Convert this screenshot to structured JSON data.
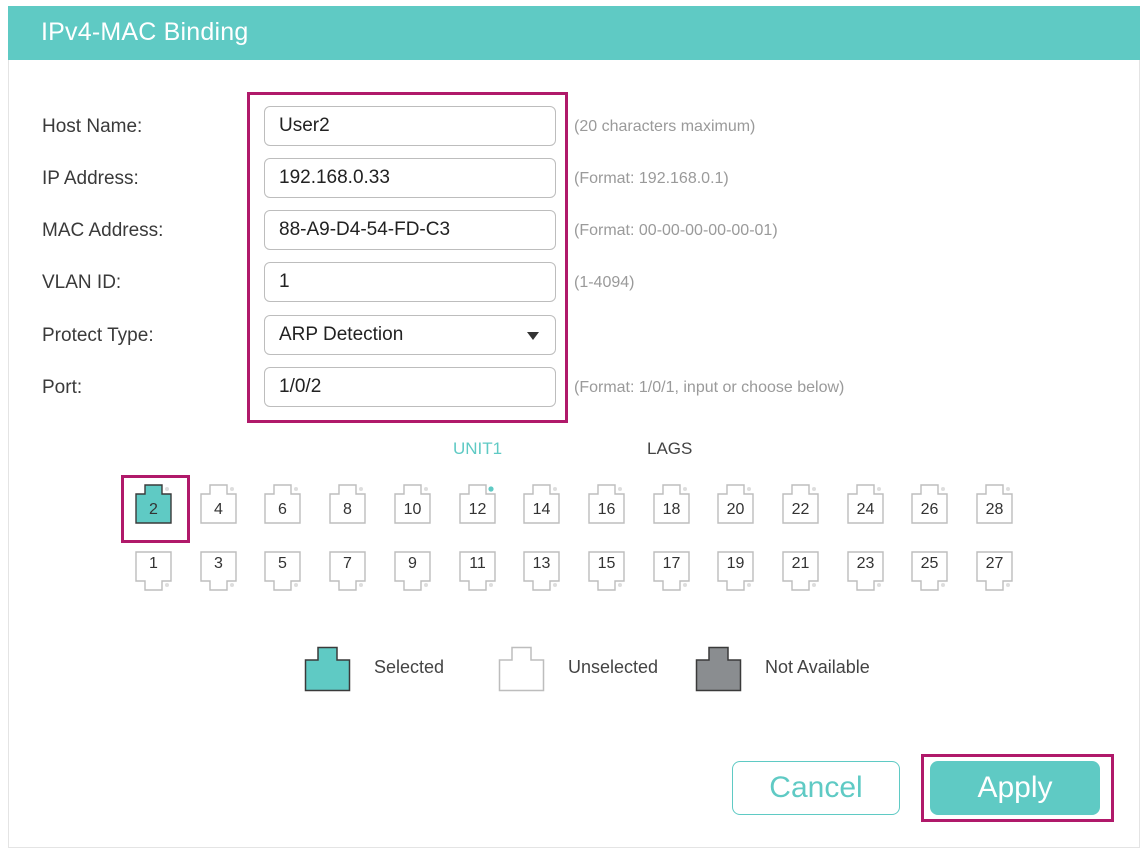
{
  "window": {
    "title": "IPv4-MAC Binding"
  },
  "form": {
    "host_name": {
      "label": "Host Name:",
      "value": "User2",
      "hint": "(20 characters maximum)"
    },
    "ip_address": {
      "label": "IP Address:",
      "value": "192.168.0.33",
      "hint": "(Format: 192.168.0.1)"
    },
    "mac_address": {
      "label": "MAC Address:",
      "value": "88-A9-D4-54-FD-C3",
      "hint": "(Format: 00-00-00-00-00-01)"
    },
    "vlan_id": {
      "label": "VLAN ID:",
      "value": "1",
      "hint": "(1-4094)"
    },
    "protect_type": {
      "label": "Protect Type:",
      "value": "ARP Detection"
    },
    "port": {
      "label": "Port:",
      "value": "1/0/2",
      "hint": "(Format: 1/0/1, input or choose below)"
    }
  },
  "tabs": {
    "unit1": "UNIT1",
    "lags": "LAGS",
    "active": "unit1"
  },
  "ports": {
    "top_row": [
      "2",
      "4",
      "6",
      "8",
      "10",
      "12",
      "14",
      "16",
      "18",
      "20",
      "22",
      "24",
      "26",
      "28"
    ],
    "bottom_row": [
      "1",
      "3",
      "5",
      "7",
      "9",
      "11",
      "13",
      "15",
      "17",
      "19",
      "21",
      "23",
      "25",
      "27"
    ],
    "selected": [
      "2"
    ],
    "link_up": [
      "12"
    ]
  },
  "legend": {
    "selected": "Selected",
    "unselected": "Unselected",
    "not_available": "Not Available"
  },
  "buttons": {
    "cancel": "Cancel",
    "apply": "Apply"
  },
  "colors": {
    "accent": "#5fcac4",
    "highlight_box": "#b0196a",
    "not_available": "#8a8d90"
  }
}
